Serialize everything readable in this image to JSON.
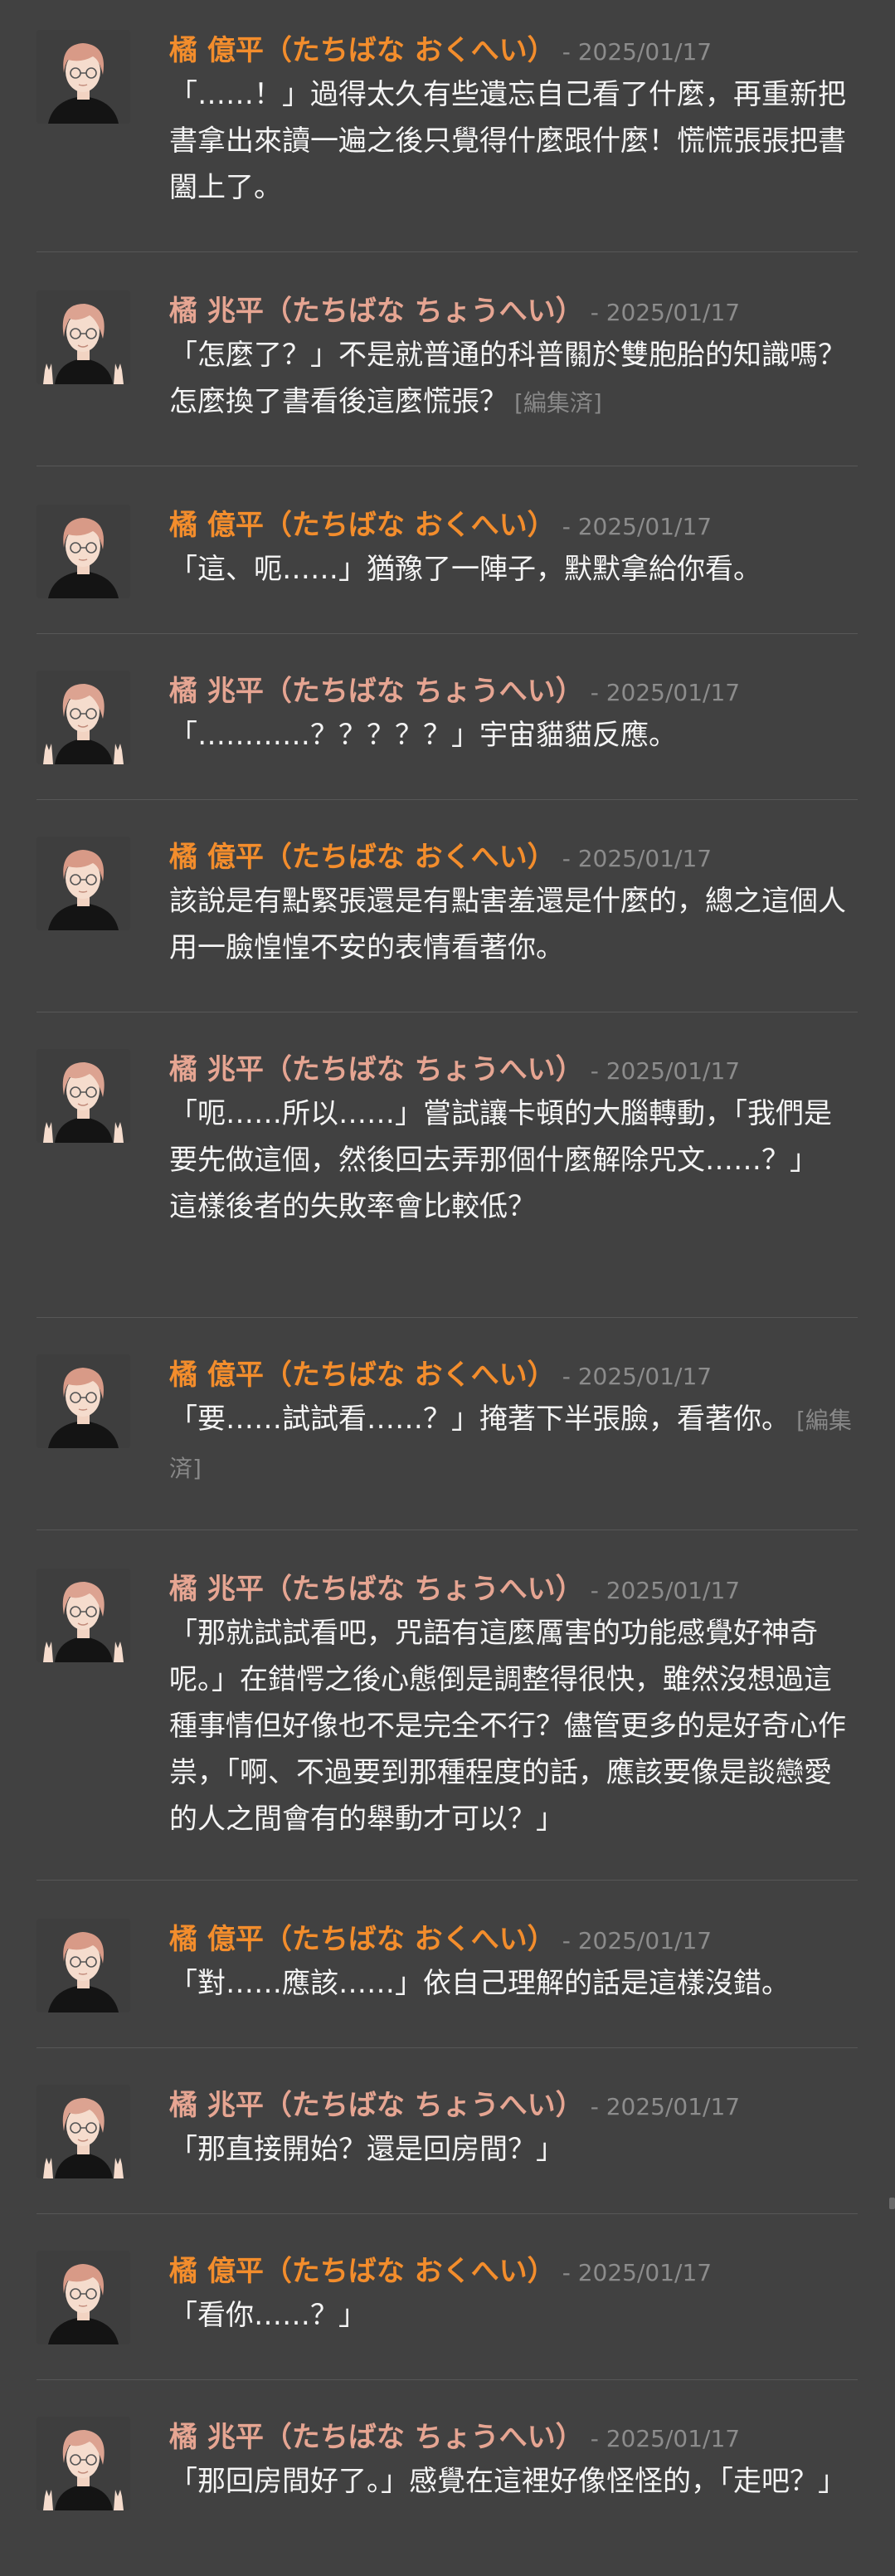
{
  "characters": {
    "okuhei": {
      "name": "橘 億平（たちばな おくへい）",
      "name_color": "#f38d2c"
    },
    "chohei": {
      "name": "橘 兆平（たちばな ちょうへい）",
      "name_color": "#e6a592"
    }
  },
  "edited_label": "[編集済]",
  "messages": [
    {
      "speaker": "okuhei",
      "date": "- 2025/01/17",
      "text": "「……！」過得太久有些遺忘自己看了什麼，再重新把書拿出來讀一遍之後只覺得什麼跟什麼！慌慌張張把書闔上了。",
      "edited": false
    },
    {
      "speaker": "chohei",
      "date": "- 2025/01/17",
      "text": "「怎麼了？」不是就普通的科普關於雙胞胎的知識嗎？怎麼換了書看後這麼慌張？",
      "edited": true
    },
    {
      "speaker": "okuhei",
      "date": "- 2025/01/17",
      "text": "「這、呃……」猶豫了一陣子，默默拿給你看。",
      "edited": false
    },
    {
      "speaker": "chohei",
      "date": "- 2025/01/17",
      "text": "「…………？？？？？」宇宙貓貓反應。",
      "edited": false
    },
    {
      "speaker": "okuhei",
      "date": "- 2025/01/17",
      "text": "該說是有點緊張還是有點害羞還是什麼的，總之這個人用一臉惶惶不安的表情看著你。",
      "edited": false
    },
    {
      "speaker": "chohei",
      "date": "- 2025/01/17",
      "text": "「呃……所以……」嘗試讓卡頓的大腦轉動，「我們是要先做這個，然後回去弄那個什麼解除咒文……？」\n這樣後者的失敗率會比較低？",
      "edited": false
    },
    {
      "speaker": "okuhei",
      "date": "- 2025/01/17",
      "text": "「要……試試看……？」掩著下半張臉，看著你。",
      "edited": true
    },
    {
      "speaker": "chohei",
      "date": "- 2025/01/17",
      "text": "「那就試試看吧，咒語有這麼厲害的功能感覺好神奇呢。」在錯愕之後心態倒是調整得很快，雖然沒想過這種事情但好像也不是完全不行？儘管更多的是好奇心作祟，「啊、不過要到那種程度的話，應該要像是談戀愛的人之間會有的舉動才可以？」",
      "edited": false
    },
    {
      "speaker": "okuhei",
      "date": "- 2025/01/17",
      "text": "「對……應該……」依自己理解的話是這樣沒錯。",
      "edited": false
    },
    {
      "speaker": "chohei",
      "date": "- 2025/01/17",
      "text": "「那直接開始？還是回房間？」",
      "edited": false
    },
    {
      "speaker": "okuhei",
      "date": "- 2025/01/17",
      "text": "「看你……？」",
      "edited": false
    },
    {
      "speaker": "chohei",
      "date": "- 2025/01/17",
      "text": "「那回房間好了。」感覺在這裡好像怪怪的，「走吧？」",
      "edited": false
    }
  ]
}
